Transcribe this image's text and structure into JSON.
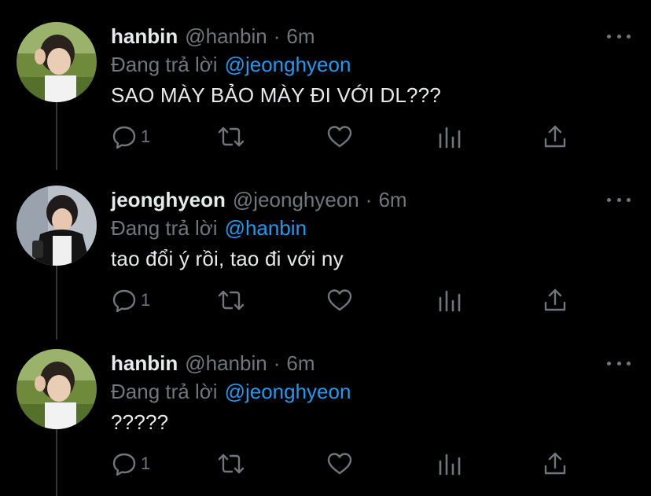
{
  "tweets": [
    {
      "name": "hanbin",
      "handle": "@hanbin",
      "separator": "·",
      "time": "6m",
      "reply_prefix": "Đang trả lời",
      "reply_to": "@jeonghyeon",
      "text": "SAO MÀY BẢO MÀY ĐI VỚI DL???",
      "reply_count": "1",
      "icons": [
        "reply-icon",
        "retweet-icon",
        "like-icon",
        "analytics-icon",
        "share-icon"
      ]
    },
    {
      "name": "jeonghyeon",
      "handle": "@jeonghyeon",
      "separator": "·",
      "time": "6m",
      "reply_prefix": "Đang trả lời",
      "reply_to": "@hanbin",
      "text": "tao đổi ý rồi, tao đi với ny",
      "reply_count": "1",
      "icons": [
        "reply-icon",
        "retweet-icon",
        "like-icon",
        "analytics-icon",
        "share-icon"
      ]
    },
    {
      "name": "hanbin",
      "handle": "@hanbin",
      "separator": "·",
      "time": "6m",
      "reply_prefix": "Đang trả lời",
      "reply_to": "@jeonghyeon",
      "text": "?????",
      "reply_count": "1",
      "icons": [
        "reply-icon",
        "retweet-icon",
        "like-icon",
        "analytics-icon",
        "share-icon"
      ]
    }
  ],
  "colors": {
    "background": "#000000",
    "primary_text": "#e7e9ea",
    "secondary_text": "#71767b",
    "mention": "#1d9bf0",
    "thread_line": "#333639"
  }
}
